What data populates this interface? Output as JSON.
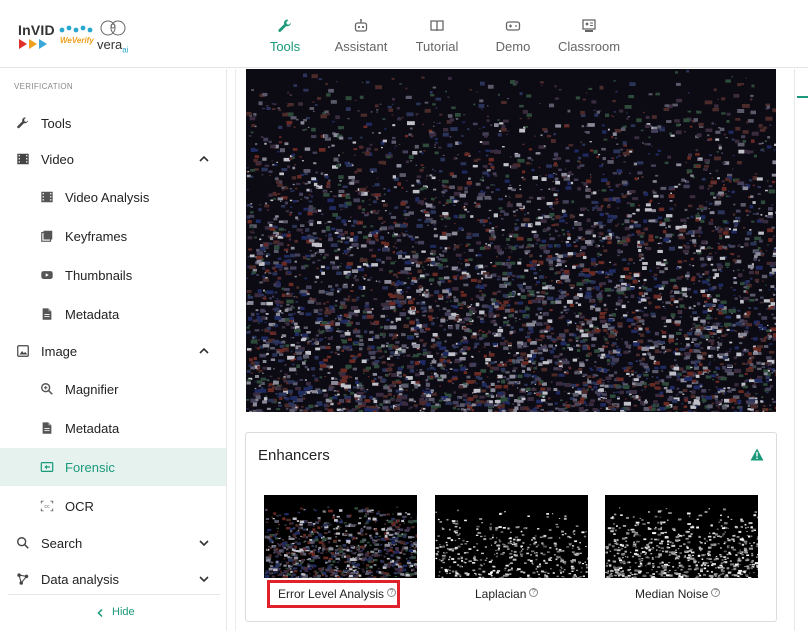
{
  "nav": {
    "items": [
      {
        "label": "Tools",
        "icon": "wrench-icon",
        "active": true
      },
      {
        "label": "Assistant",
        "icon": "robot-icon",
        "active": false
      },
      {
        "label": "Tutorial",
        "icon": "book-icon",
        "active": false
      },
      {
        "label": "Demo",
        "icon": "gamepad-icon",
        "active": false
      },
      {
        "label": "Classroom",
        "icon": "classroom-icon",
        "active": false
      }
    ]
  },
  "logo": {
    "invid": "InVID",
    "weverify": "WeVerify",
    "vera": "vera",
    "vera_suffix": "ai"
  },
  "sidebar": {
    "section": "VERIFICATION",
    "items": [
      {
        "label": "Tools",
        "icon": "wrench-icon"
      },
      {
        "label": "Video",
        "icon": "film-icon",
        "expanded": true
      },
      {
        "label": "Video Analysis",
        "icon": "film-strip-icon"
      },
      {
        "label": "Keyframes",
        "icon": "keyframes-icon"
      },
      {
        "label": "Thumbnails",
        "icon": "youtube-icon"
      },
      {
        "label": "Metadata",
        "icon": "document-icon"
      },
      {
        "label": "Image",
        "icon": "image-icon",
        "expanded": true
      },
      {
        "label": "Magnifier",
        "icon": "magnifier-icon"
      },
      {
        "label": "Metadata",
        "icon": "document-icon"
      },
      {
        "label": "Forensic",
        "icon": "forensic-icon",
        "active": true
      },
      {
        "label": "OCR",
        "icon": "ocr-icon"
      },
      {
        "label": "Search",
        "icon": "search-icon",
        "expanded": false
      },
      {
        "label": "Data analysis",
        "icon": "graph-icon",
        "expanded": false
      }
    ],
    "hide_label": "Hide"
  },
  "enhancers": {
    "title": "Enhancers",
    "thumbs": [
      {
        "label": "Error Level Analysis",
        "selected": true
      },
      {
        "label": "Laplacian",
        "selected": false
      },
      {
        "label": "Median Noise",
        "selected": false
      }
    ]
  },
  "colors": {
    "accent": "#1a9a7a",
    "highlight": "#e0202a",
    "active_bg": "#e6f2ee"
  }
}
